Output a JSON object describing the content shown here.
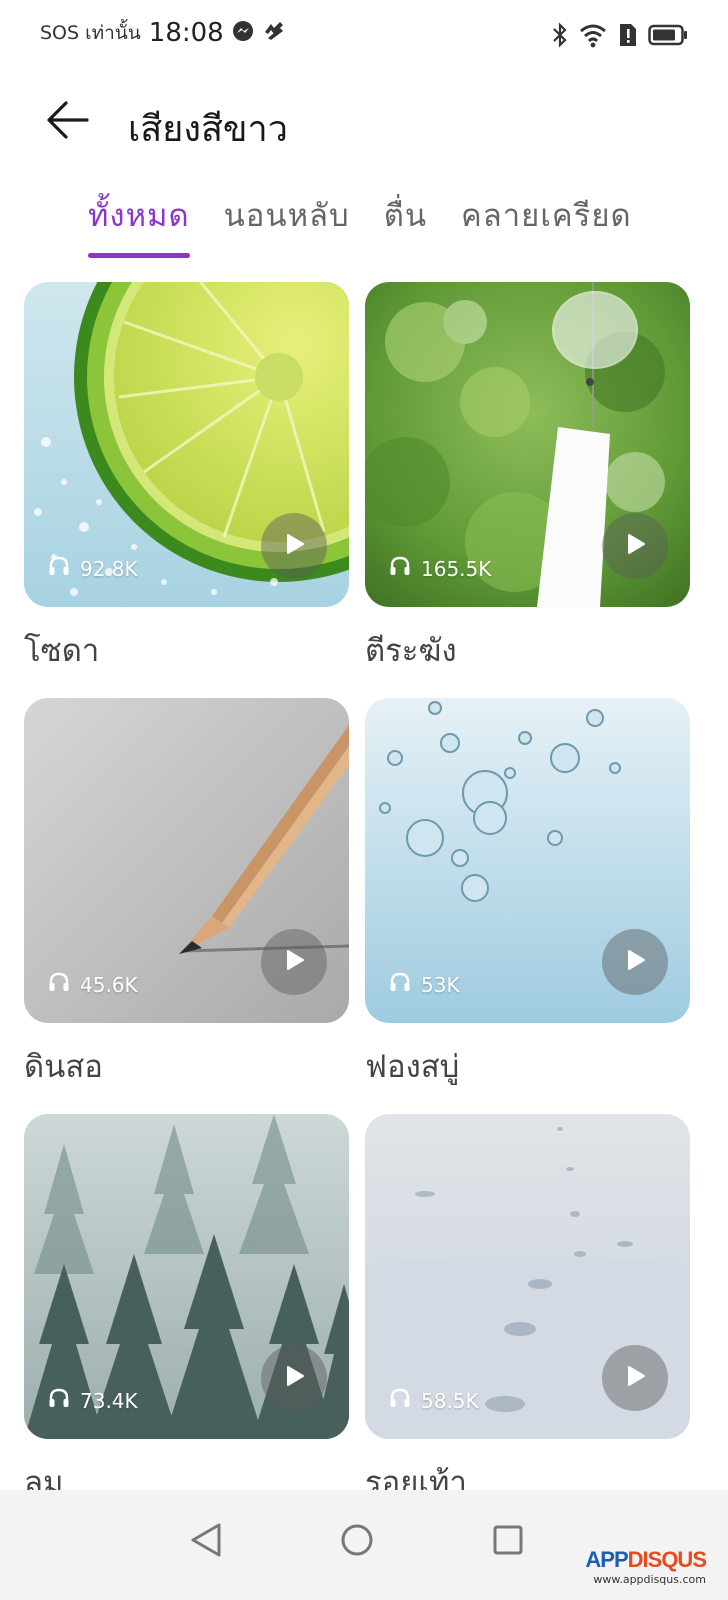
{
  "status_bar": {
    "carrier": "SOS เท่านั้น",
    "time": "18:08",
    "left_icons": [
      "messenger-icon",
      "app-notification-icon"
    ],
    "right_icons": [
      "bluetooth-icon",
      "wifi-icon",
      "sim-alert-icon",
      "battery-icon"
    ]
  },
  "header": {
    "back_icon": "arrow-left-icon",
    "title": "เสียงสีขาว"
  },
  "tabs": [
    {
      "label": "ทั้งหมด",
      "active": true
    },
    {
      "label": "นอนหลับ",
      "active": false
    },
    {
      "label": "ตื่น",
      "active": false
    },
    {
      "label": "คลายเครียด",
      "active": false
    }
  ],
  "sounds": [
    {
      "name": "โซดา",
      "plays": "92.8K",
      "image": "lime-slice-in-soda"
    },
    {
      "name": "ตีระฆัง",
      "plays": "165.5K",
      "image": "glass-wind-chime"
    },
    {
      "name": "ดินสอ",
      "plays": "45.6K",
      "image": "pencil-tip"
    },
    {
      "name": "ฟองสบู่",
      "plays": "53K",
      "image": "underwater-bubbles"
    },
    {
      "name": "ลม",
      "plays": "73.4K",
      "image": "misty-forest"
    },
    {
      "name": "รอยเท้า",
      "plays": "58.5K",
      "image": "snow-footprints"
    }
  ],
  "nav_bar": {
    "back_icon": "triangle-back-icon",
    "home_icon": "circle-home-icon",
    "recents_icon": "square-recents-icon"
  },
  "watermark": {
    "logo_a": "APP",
    "logo_b": "DISQUS",
    "url": "www.appdisqus.com"
  },
  "colors": {
    "accent": "#8b35c9",
    "text": "#1f1f1f",
    "nav_bg": "#f3f3f3"
  }
}
